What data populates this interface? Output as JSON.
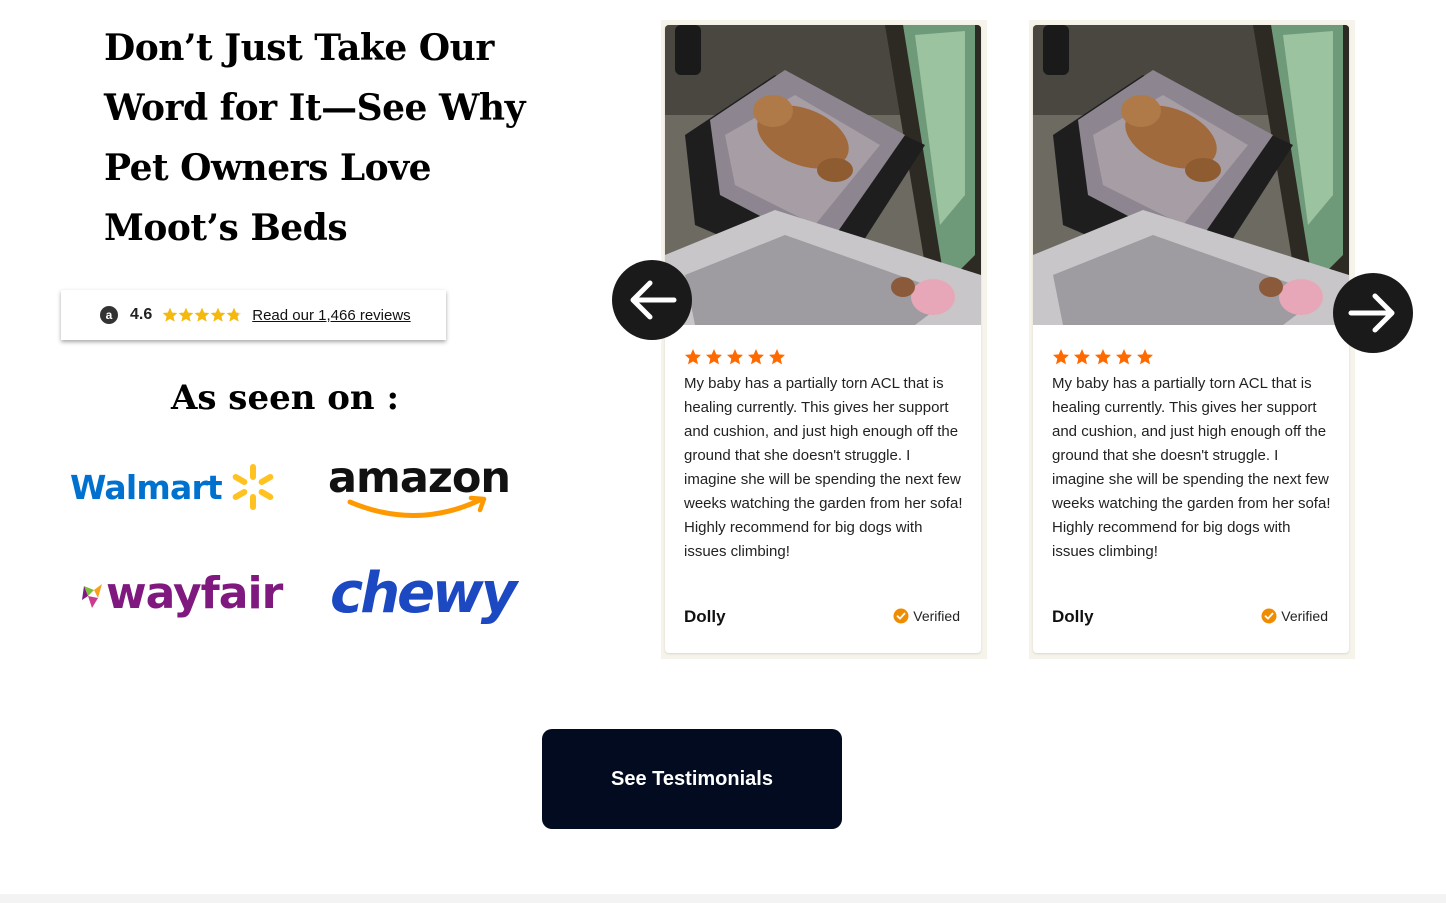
{
  "headline": "Don’t Just Take Our Word for It—See Why Pet Owners Love Moot’s Beds",
  "rating": {
    "badge_letter": "a",
    "value": "4.6",
    "stars": 4.6,
    "star_color": "#f5b80b",
    "link_text": "Read our 1,466 reviews"
  },
  "seen_on": {
    "title": "As seen on :",
    "logos": {
      "walmart": "Walmart",
      "amazon": "amazon",
      "wayfair": "wayfair",
      "chewy": "chewy"
    }
  },
  "reviews": [
    {
      "stars": 5,
      "text": "My baby has a partially torn ACL that is healing currently. This gives her support and cushion, and just high enough off the ground that she doesn't struggle. I imagine she will be spending the next few weeks watching the garden from her sofa! Highly recommend for big dogs with issues climbing!",
      "author": "Dolly",
      "verified": "Verified",
      "photo_icon": "dog-on-bed-photo"
    },
    {
      "stars": 5,
      "text": "My baby has a partially torn ACL that is healing currently. This gives her support and cushion, and just high enough off the ground that she doesn't struggle. I imagine she will be spending the next few weeks watching the garden from her sofa! Highly recommend for big dogs with issues climbing!",
      "author": "Dolly",
      "verified": "Verified",
      "photo_icon": "dog-on-bed-photo"
    }
  ],
  "carousel": {
    "prev_icon": "arrow-left-icon",
    "next_icon": "arrow-right-icon"
  },
  "cta_label": "See Testimonials",
  "colors": {
    "review_star": "#ff6a00",
    "verified": "#f08c00",
    "cta_bg": "#020b1f",
    "walmart_blue": "#0071ce",
    "walmart_yellow": "#ffc220",
    "amazon_orange": "#ff9900",
    "wayfair_purple": "#7f187f",
    "chewy_blue": "#1c49c2"
  }
}
